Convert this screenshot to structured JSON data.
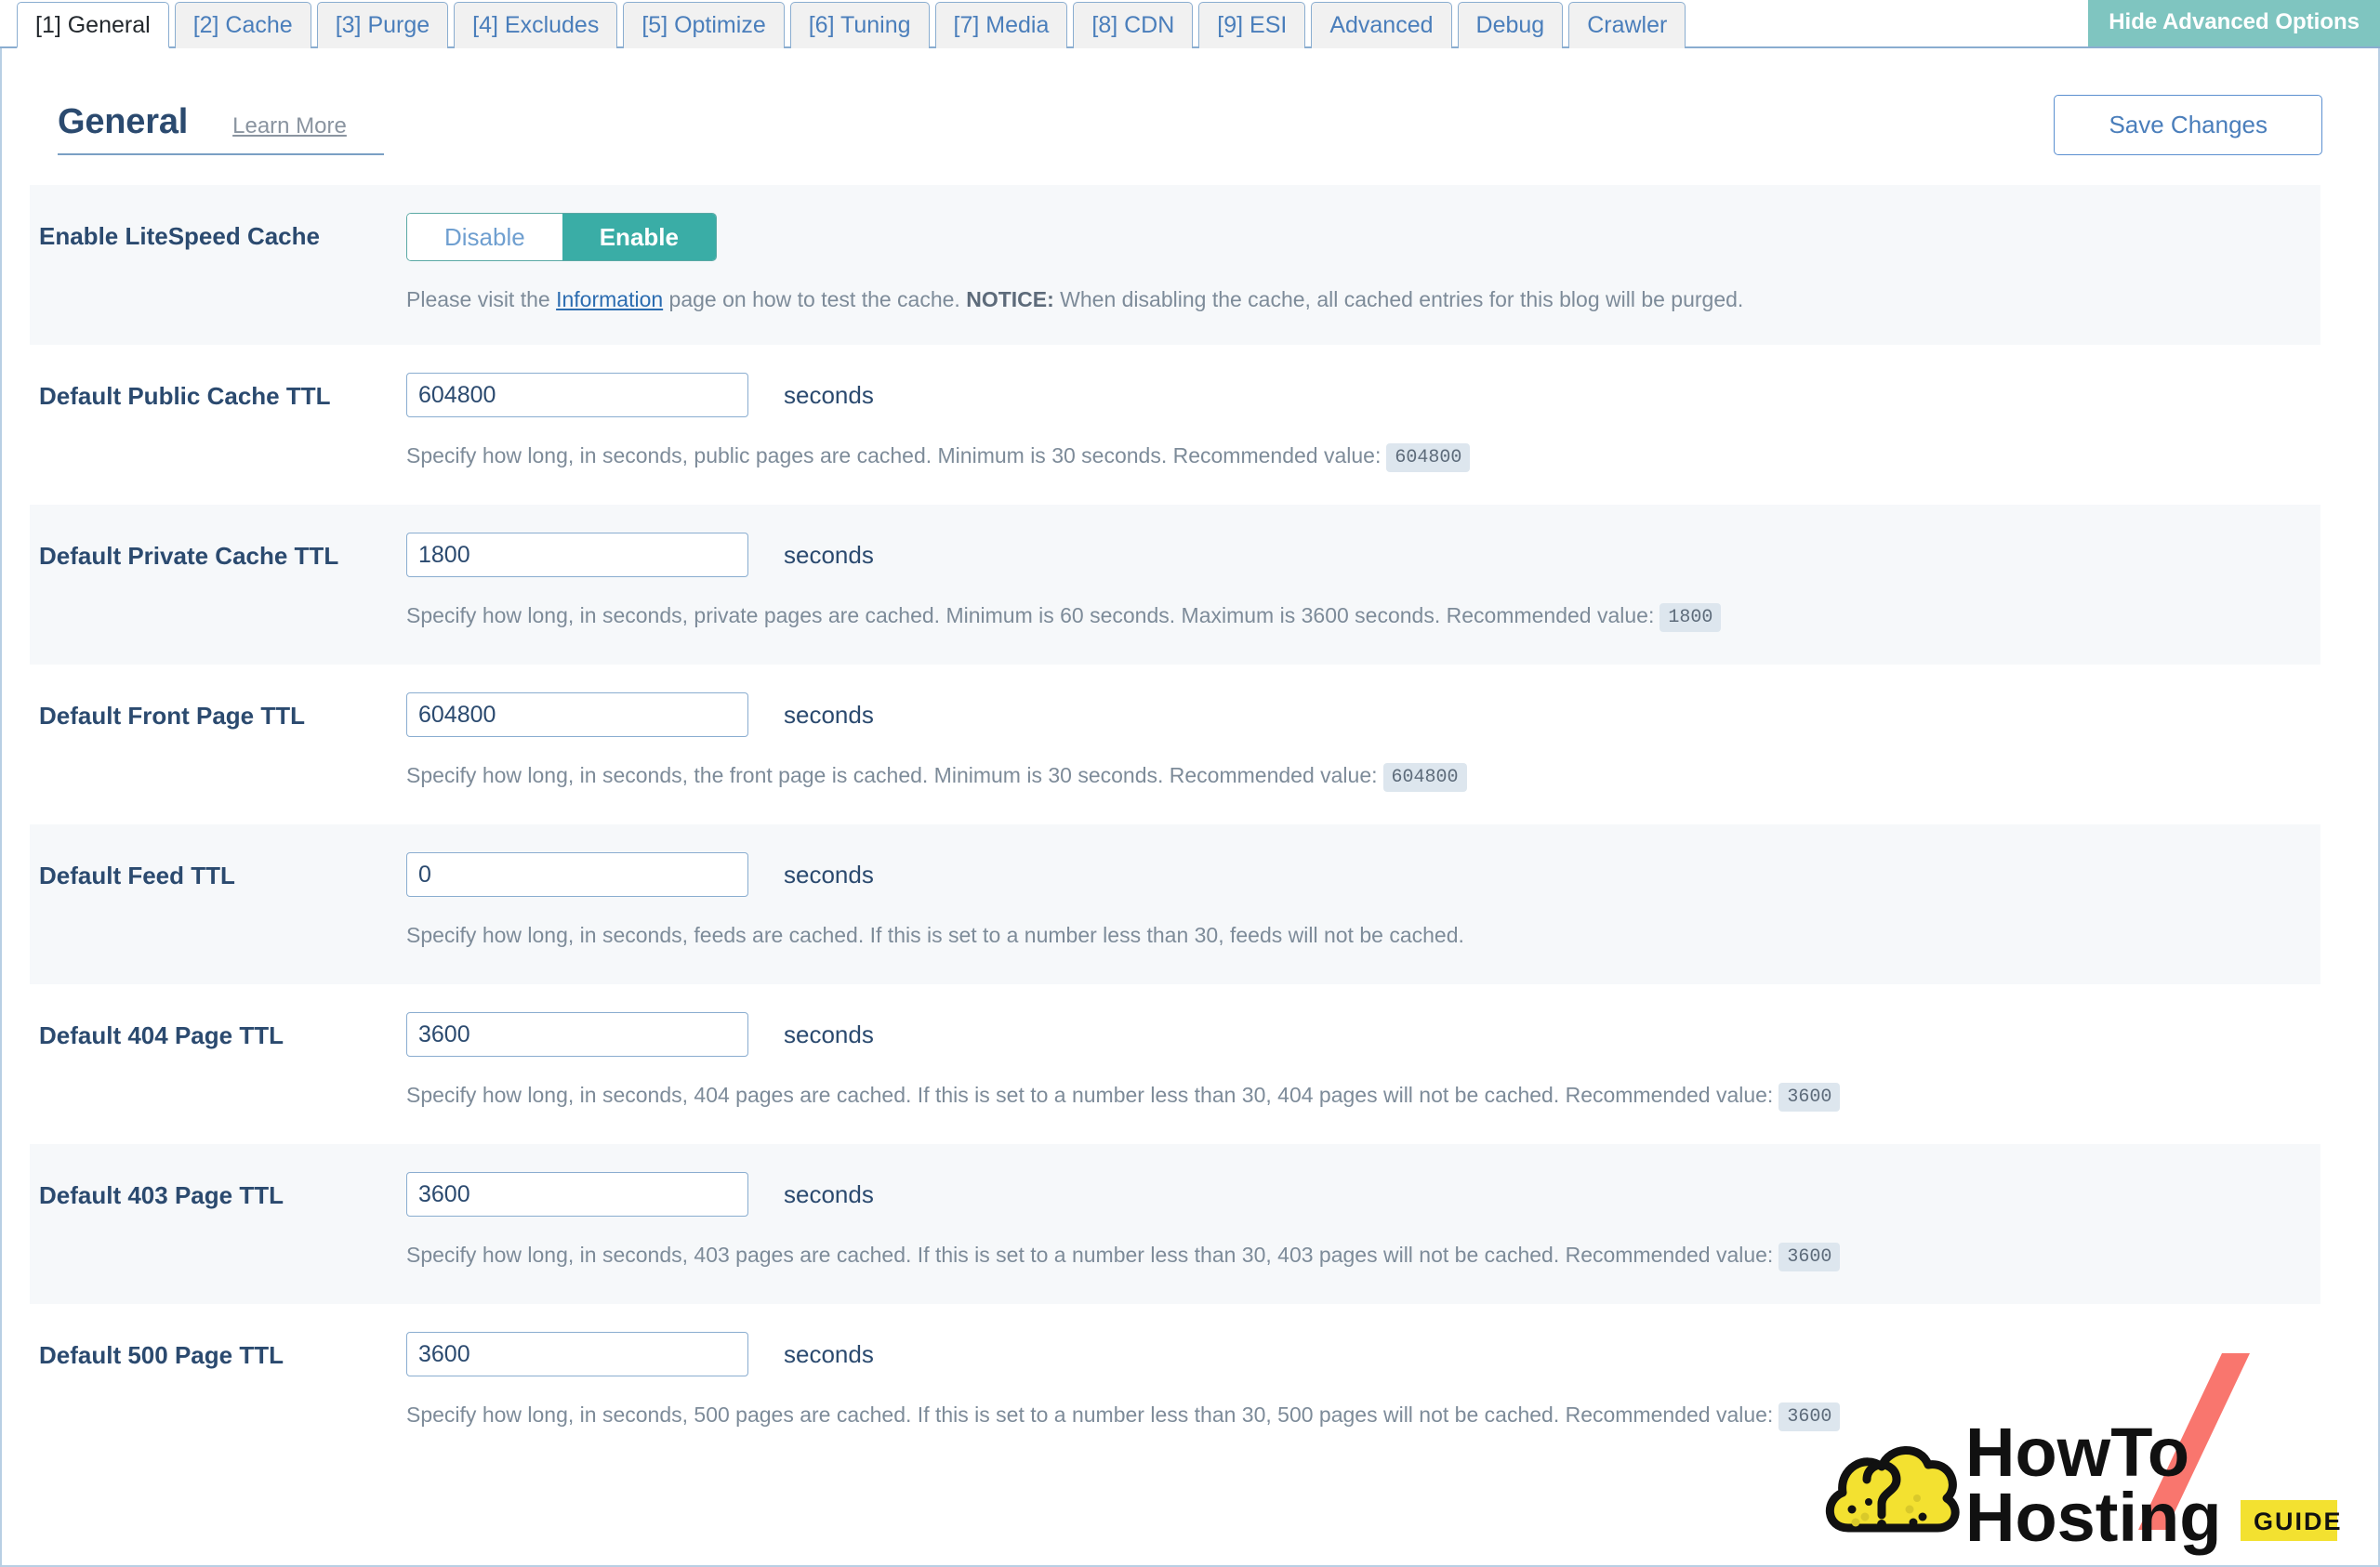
{
  "tabs": [
    {
      "label": "[1] General",
      "active": true
    },
    {
      "label": "[2] Cache",
      "active": false
    },
    {
      "label": "[3] Purge",
      "active": false
    },
    {
      "label": "[4] Excludes",
      "active": false
    },
    {
      "label": "[5] Optimize",
      "active": false
    },
    {
      "label": "[6] Tuning",
      "active": false
    },
    {
      "label": "[7] Media",
      "active": false
    },
    {
      "label": "[8] CDN",
      "active": false
    },
    {
      "label": "[9] ESI",
      "active": false
    },
    {
      "label": "Advanced",
      "active": false
    },
    {
      "label": "Debug",
      "active": false
    },
    {
      "label": "Crawler",
      "active": false
    }
  ],
  "advanced_toggle_label": "Hide Advanced Options",
  "header": {
    "title": "General",
    "learn_more": "Learn More",
    "save_label": "Save Changes"
  },
  "colors": {
    "accent_teal": "#3aada6",
    "link_blue": "#2b6cb0",
    "title_navy": "#2b4a6f",
    "tab_border": "#8aadd0",
    "adv_toggle_bg": "#7fc5c0",
    "row_shade": "#f6f8fa",
    "logo_yellow": "#f3e130",
    "logo_red": "#f9766e"
  },
  "rows": [
    {
      "name": "enable-litespeed-cache",
      "label": "Enable LiteSpeed Cache",
      "type": "toggle",
      "options": [
        "Disable",
        "Enable"
      ],
      "selected": "Enable",
      "desc_pre": "Please visit the ",
      "desc_link": "Information",
      "desc_mid": " page on how to test the cache. ",
      "desc_notice": "NOTICE:",
      "desc_post": " When disabling the cache, all cached entries for this blog will be purged."
    },
    {
      "name": "default-public-cache-ttl",
      "label": "Default Public Cache TTL",
      "type": "text",
      "value": "604800",
      "unit": "seconds",
      "desc": "Specify how long, in seconds, public pages are cached. Minimum is 30 seconds. Recommended value:",
      "recommended": "604800"
    },
    {
      "name": "default-private-cache-ttl",
      "label": "Default Private Cache TTL",
      "type": "text",
      "value": "1800",
      "unit": "seconds",
      "desc": "Specify how long, in seconds, private pages are cached. Minimum is 60 seconds. Maximum is 3600 seconds. Recommended value:",
      "recommended": "1800"
    },
    {
      "name": "default-front-page-ttl",
      "label": "Default Front Page TTL",
      "type": "text",
      "value": "604800",
      "unit": "seconds",
      "desc": "Specify how long, in seconds, the front page is cached. Minimum is 30 seconds. Recommended value:",
      "recommended": "604800"
    },
    {
      "name": "default-feed-ttl",
      "label": "Default Feed TTL",
      "type": "text",
      "value": "0",
      "unit": "seconds",
      "desc": "Specify how long, in seconds, feeds are cached. If this is set to a number less than 30, feeds will not be cached.",
      "recommended": ""
    },
    {
      "name": "default-404-page-ttl",
      "label": "Default 404 Page TTL",
      "type": "text",
      "value": "3600",
      "unit": "seconds",
      "desc": "Specify how long, in seconds, 404 pages are cached. If this is set to a number less than 30, 404 pages will not be cached. Recommended value:",
      "recommended": "3600"
    },
    {
      "name": "default-403-page-ttl",
      "label": "Default 403 Page TTL",
      "type": "text",
      "value": "3600",
      "unit": "seconds",
      "desc": "Specify how long, in seconds, 403 pages are cached. If this is set to a number less than 30, 403 pages will not be cached. Recommended value:",
      "recommended": "3600"
    },
    {
      "name": "default-500-page-ttl",
      "label": "Default 500 Page TTL",
      "type": "text",
      "value": "3600",
      "unit": "seconds",
      "desc": "Specify how long, in seconds, 500 pages are cached. If this is set to a number less than 30, 500 pages will not be cached. Recommended value:",
      "recommended": "3600"
    }
  ],
  "logo": {
    "line1": "HowTo",
    "line2": "Hosting",
    "badge": "GUIDE"
  }
}
